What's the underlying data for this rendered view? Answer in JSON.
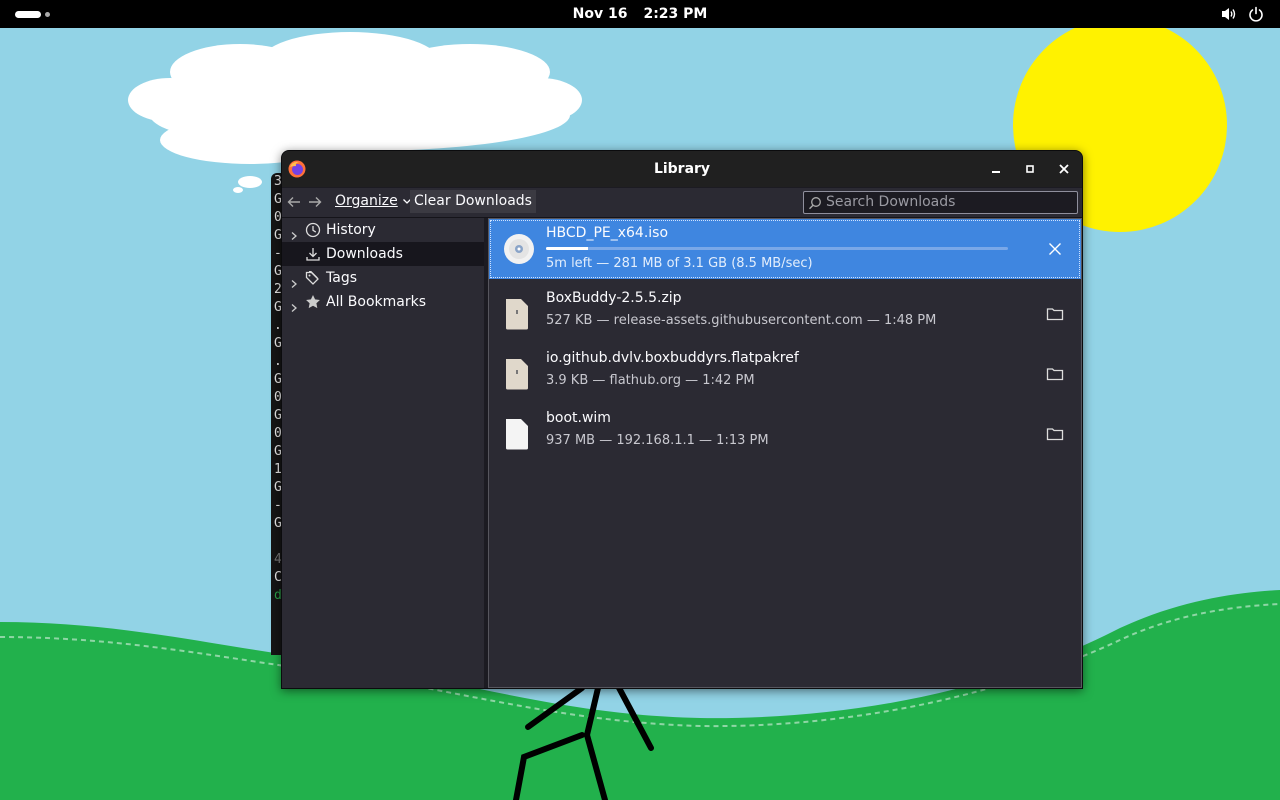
{
  "topbar": {
    "date": "Nov 16",
    "time": "2:23 PM",
    "icons": [
      "activities-pill",
      "volume-icon",
      "power-icon"
    ]
  },
  "terminal": {
    "lines": [
      "3",
      "G",
      "0",
      "G",
      "-",
      "G",
      "2",
      "G",
      ".",
      "G",
      ".",
      "G",
      "0",
      "G",
      "0",
      "G",
      "1",
      "G",
      "-",
      "G",
      "",
      "4",
      "C",
      "d"
    ]
  },
  "window": {
    "title": "Library",
    "controls": [
      "minimize-icon",
      "maximize-icon",
      "close-icon"
    ]
  },
  "toolbar": {
    "organize_label": "Organize",
    "clear_label": "Clear Downloads",
    "search_placeholder": "Search Downloads"
  },
  "sidebar": {
    "items": [
      {
        "label": "History",
        "icon": "clock-icon",
        "expandable": true,
        "selected": false
      },
      {
        "label": "Downloads",
        "icon": "download-icon",
        "expandable": false,
        "selected": true
      },
      {
        "label": "Tags",
        "icon": "tags-icon",
        "expandable": true,
        "selected": false
      },
      {
        "label": "All Bookmarks",
        "icon": "star-icon",
        "expandable": true,
        "selected": false
      }
    ]
  },
  "downloads": [
    {
      "name": "HBCD_PE_x64.iso",
      "status": "5m left — 281 MB of 3.1 GB (8.5 MB/sec)",
      "progress": 0.09,
      "in_progress": true,
      "icon": "disc-icon",
      "action": "cancel"
    },
    {
      "name": "BoxBuddy-2.5.5.zip",
      "status": "527 KB — release-assets.githubusercontent.com — 1:48 PM",
      "in_progress": false,
      "icon": "archive-icon",
      "action": "show-in-folder"
    },
    {
      "name": "io.github.dvlv.boxbuddyrs.flatpakref",
      "status": "3.9 KB — flathub.org — 1:42 PM",
      "in_progress": false,
      "icon": "archive-icon",
      "action": "show-in-folder"
    },
    {
      "name": "boot.wim",
      "status": "937 MB — 192.168.1.1 — 1:13 PM",
      "in_progress": false,
      "icon": "file-icon",
      "action": "show-in-folder"
    }
  ],
  "colors": {
    "sky": "#92d3e6",
    "grass": "#22b14c",
    "sun": "#fff200",
    "accent": "#3f86e0",
    "panel": "#2b2a33"
  }
}
